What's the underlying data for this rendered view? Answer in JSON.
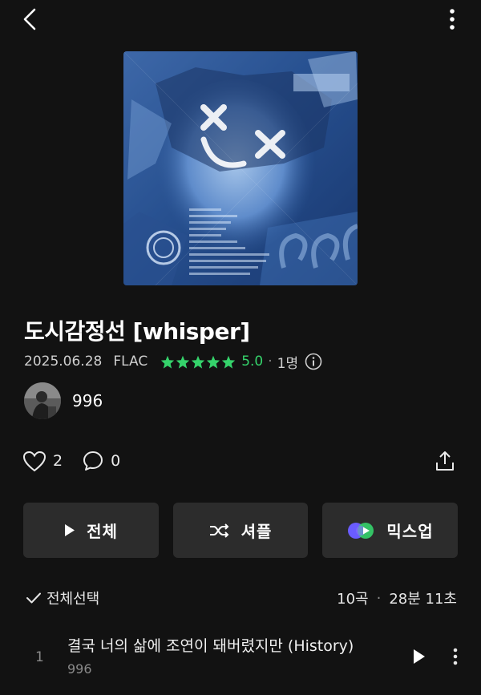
{
  "album": {
    "title": "도시감정선 [whisper]",
    "release_date": "2025.06.28",
    "format": "FLAC",
    "rating": "5.0",
    "rating_stars": 5,
    "rating_count": "1명"
  },
  "artist": {
    "name": "996"
  },
  "social": {
    "likes": "2",
    "comments": "0"
  },
  "actions": {
    "play_all": "전체",
    "shuffle": "셔플",
    "mixup": "믹스업"
  },
  "tracklist": {
    "select_all": "전체선택",
    "count": "10곡",
    "duration": "28분 11초",
    "tracks": [
      {
        "number": "1",
        "title": "결국 너의 삶에 조연이 돼버렸지만 (History)",
        "artist": "996"
      }
    ]
  },
  "colors": {
    "background": "#121212",
    "button": "#2c2c2c",
    "accent_green": "#35d36b"
  },
  "icons": [
    "back-arrow-icon",
    "more-vertical-icon",
    "star-icon",
    "info-icon",
    "heart-icon",
    "comment-icon",
    "share-icon",
    "play-icon",
    "shuffle-icon",
    "mixup-icon",
    "check-icon"
  ]
}
